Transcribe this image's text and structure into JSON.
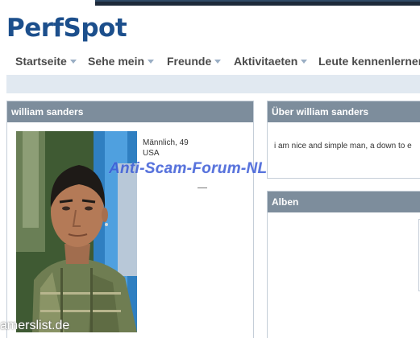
{
  "site": {
    "logo": "PerfSpot"
  },
  "nav": {
    "items": [
      {
        "label": "Startseite",
        "has_dropdown": true
      },
      {
        "label": "Sehe mein",
        "has_dropdown": true
      },
      {
        "label": "Freunde",
        "has_dropdown": true
      },
      {
        "label": "Aktivitaeten",
        "has_dropdown": true
      },
      {
        "label": "Leute kennenlernen",
        "has_dropdown": false
      }
    ]
  },
  "profile": {
    "header": "william sanders",
    "gender_age": "Männlich, 49",
    "country": "USA"
  },
  "about": {
    "header": "Über william sanders",
    "text": "i am nice and simple man, a down to e"
  },
  "albums": {
    "header": "Alben"
  },
  "watermarks": {
    "center": "Anti-Scam-Forum-NL",
    "bottom": "amerslist.de"
  },
  "colors": {
    "brand": "#1c4f8c",
    "panel_header": "#7d8d9c",
    "subbar": "#e1e9f1",
    "watermark": "#3b5bd6"
  }
}
